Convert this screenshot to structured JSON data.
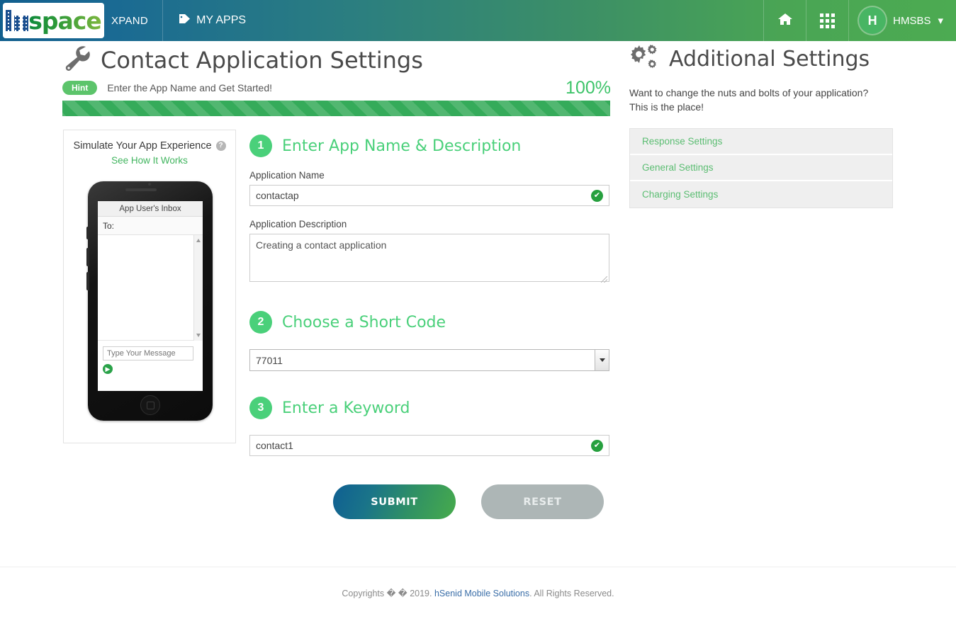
{
  "header": {
    "logo_prefix": "m",
    "logo_text": "space",
    "xpand_label": "XPAND",
    "my_apps_label": "MY APPS",
    "tag_icon": "tag-icon",
    "home_icon": "home-icon",
    "apps_grid_icon": "grid-apps-icon",
    "avatar_initial": "H",
    "user_name": "HMSBS",
    "caret": "▾",
    "gradient_start": "#125f8e",
    "gradient_end": "#4cab52"
  },
  "page": {
    "wrench_icon": "wrench-icon",
    "title": "Contact Application Settings",
    "hint_badge": "Hint",
    "hint_text": "Enter the App Name and Get Started!",
    "progress_percent": "100%",
    "progress_value": 100,
    "progress_color": "#35ab5a"
  },
  "simulator": {
    "panel_title": "Simulate Your App Experience",
    "help_icon": "help-circle-icon",
    "help_glyph": "?",
    "how_it_works_label": "See How It Works",
    "inbox_title": "App User's Inbox",
    "to_label": "To:",
    "message_placeholder": "Type Your Message",
    "message_value": "",
    "send_icon": "send-arrow-icon",
    "send_glyph": "▶"
  },
  "form": {
    "steps": [
      {
        "number": "1",
        "title": "Enter App Name & Description",
        "name_label": "Application Name",
        "name_value": "contactap",
        "name_valid_icon": "check-circle-icon",
        "desc_label": "Application Description",
        "desc_value": "Creating a contact application"
      },
      {
        "number": "2",
        "title": "Choose a Short Code",
        "shortcode_value": "77011",
        "dropdown_icon": "chevron-down-icon"
      },
      {
        "number": "3",
        "title": "Enter a Keyword",
        "keyword_value": "contact1",
        "keyword_valid_icon": "check-circle-icon"
      }
    ],
    "check_glyph": "✔",
    "submit_label": "SUBMIT",
    "reset_label": "RESET"
  },
  "sidebar": {
    "gears_icon": "gears-icon",
    "title": "Additional Settings",
    "description": "Want to change the nuts and bolts of your application? This is the place!",
    "panels": [
      {
        "label": "Response Settings"
      },
      {
        "label": "General Settings"
      },
      {
        "label": "Charging Settings"
      }
    ]
  },
  "footer": {
    "prefix": "Copyrights � � 2019.",
    "link": "hSenid Mobile Solutions",
    "suffix": ". All Rights Reserved."
  }
}
